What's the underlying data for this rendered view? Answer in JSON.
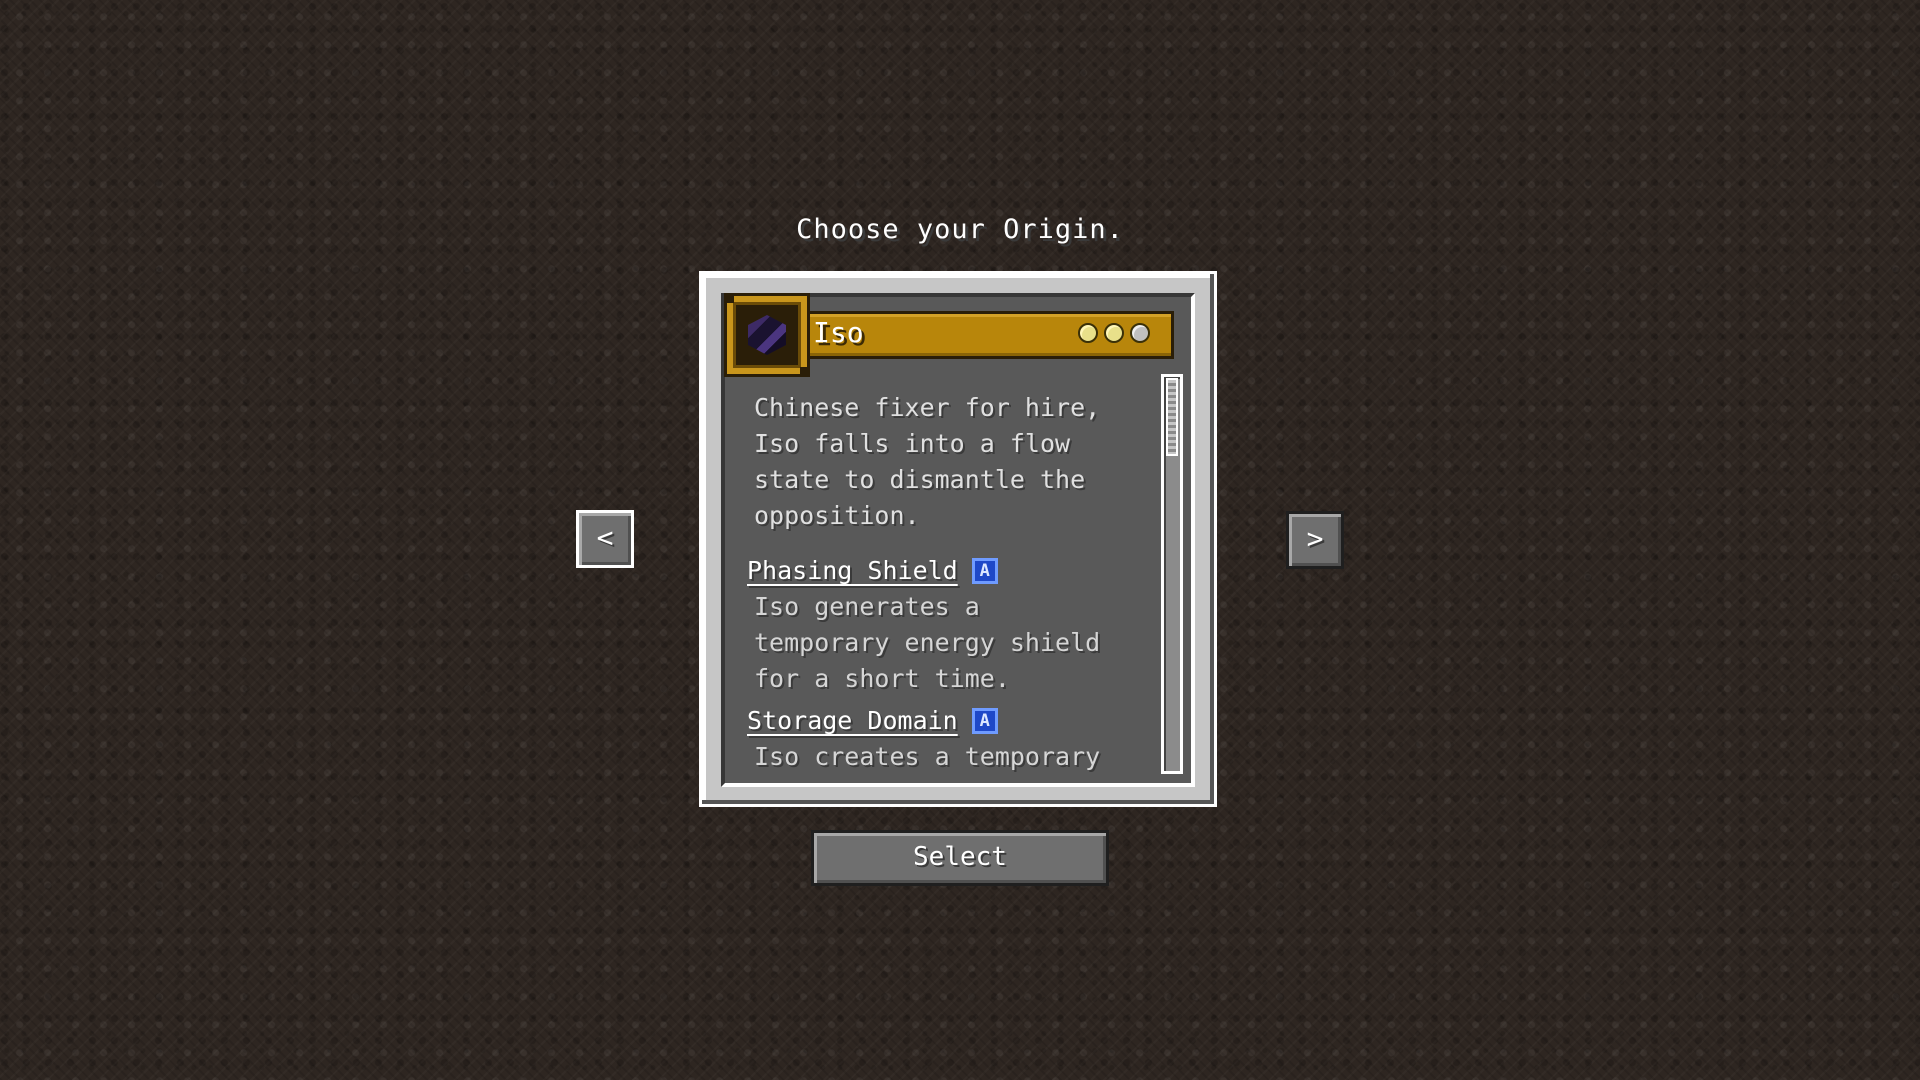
{
  "screen": {
    "title": "Choose your Origin."
  },
  "origin": {
    "name": "Iso",
    "icon": "obsidian-block-icon",
    "impact_level": 2,
    "impact_max": 3,
    "description": "Chinese fixer for hire, Iso falls into a flow state to dismantle the opposition.",
    "description_lines": [
      "Chinese fixer for hire,",
      "Iso falls into a flow",
      "state to dismantle the",
      "opposition."
    ],
    "powers": [
      {
        "name": "Phasing Shield",
        "badge": "A",
        "lines": [
          "Iso generates a",
          "temporary energy shield",
          "for a short time."
        ]
      },
      {
        "name": "Storage Domain",
        "badge": "A",
        "lines": [
          "Iso creates a temporary"
        ]
      }
    ]
  },
  "navigation": {
    "prev_label": "<",
    "next_label": ">"
  },
  "actions": {
    "select_label": "Select"
  },
  "colors": {
    "header_gold": "#b8860b",
    "badge_blue": "#1e48c8",
    "panel_dark": "#595959"
  }
}
